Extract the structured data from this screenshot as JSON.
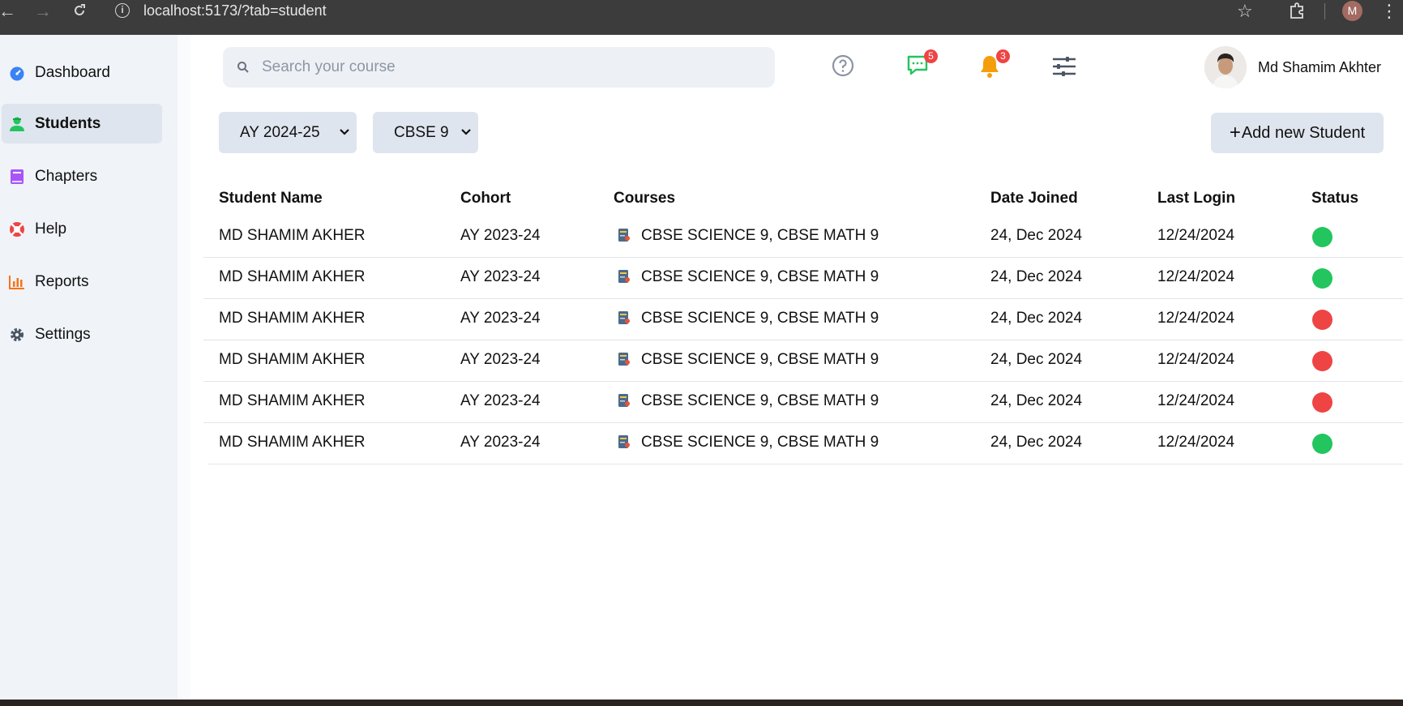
{
  "browser": {
    "url": "localhost:5173/?tab=student",
    "profile_initial": "M"
  },
  "sidebar": {
    "items": [
      {
        "label": "Dashboard",
        "icon": "dashboard-gauge-icon",
        "color": "#3b82f6",
        "active": false
      },
      {
        "label": "Students",
        "icon": "students-icon",
        "color": "#22c55e",
        "active": true
      },
      {
        "label": "Chapters",
        "icon": "book-icon",
        "color": "#a855f7",
        "active": false
      },
      {
        "label": "Help",
        "icon": "lifebuoy-icon",
        "color": "#ef4444",
        "active": false
      },
      {
        "label": "Reports",
        "icon": "bar-chart-icon",
        "color": "#f97316",
        "active": false
      },
      {
        "label": "Settings",
        "icon": "gear-icon",
        "color": "#4b5563",
        "active": false
      }
    ]
  },
  "header": {
    "search_placeholder": "Search your course",
    "messages_count": "5",
    "notifications_count": "3",
    "user_name": "Md Shamim Akhter"
  },
  "filters": {
    "year": "AY 2024-25",
    "class": "CBSE 9"
  },
  "actions": {
    "add_student": "Add new Student"
  },
  "table": {
    "headers": {
      "name": "Student Name",
      "cohort": "Cohort",
      "courses": "Courses",
      "date_joined": "Date Joined",
      "last_login": "Last Login",
      "status": "Status"
    },
    "rows": [
      {
        "name": "MD SHAMIM AKHER",
        "cohort": "AY 2023-24",
        "courses": "CBSE SCIENCE 9, CBSE MATH 9",
        "date_joined": "24, Dec 2024",
        "last_login": "12/24/2024",
        "status": "active"
      },
      {
        "name": "MD SHAMIM AKHER",
        "cohort": "AY 2023-24",
        "courses": "CBSE SCIENCE 9, CBSE MATH 9",
        "date_joined": "24, Dec 2024",
        "last_login": "12/24/2024",
        "status": "active"
      },
      {
        "name": "MD SHAMIM AKHER",
        "cohort": "AY 2023-24",
        "courses": "CBSE SCIENCE 9, CBSE MATH 9",
        "date_joined": "24, Dec 2024",
        "last_login": "12/24/2024",
        "status": "inactive"
      },
      {
        "name": "MD SHAMIM AKHER",
        "cohort": "AY 2023-24",
        "courses": "CBSE SCIENCE 9, CBSE MATH 9",
        "date_joined": "24, Dec 2024",
        "last_login": "12/24/2024",
        "status": "inactive"
      },
      {
        "name": "MD SHAMIM AKHER",
        "cohort": "AY 2023-24",
        "courses": "CBSE SCIENCE 9, CBSE MATH 9",
        "date_joined": "24, Dec 2024",
        "last_login": "12/24/2024",
        "status": "inactive"
      },
      {
        "name": "MD SHAMIM AKHER",
        "cohort": "AY 2023-24",
        "courses": "CBSE SCIENCE 9, CBSE MATH 9",
        "date_joined": "24, Dec 2024",
        "last_login": "12/24/2024",
        "status": "active"
      }
    ]
  },
  "colors": {
    "status_active": "#22c55e",
    "status_inactive": "#ef4444"
  }
}
